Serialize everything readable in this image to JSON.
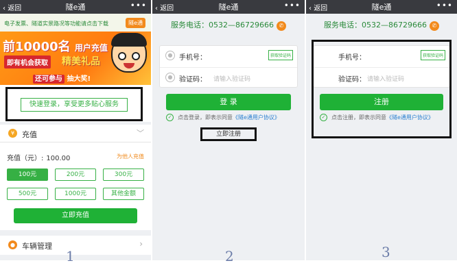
{
  "panel1": {
    "nav": {
      "back": "返回",
      "title": "隧e通",
      "more": "•••"
    },
    "notice": {
      "text": "电子发票、隧道实景路况等功能请点击下载",
      "button": "隧e通"
    },
    "banner": {
      "line1_big": "前10000名",
      "line1_small": "用户充值",
      "line2": "即有机会获取",
      "line3": "精美礼品",
      "line4_a": "还可参与",
      "line4_b": "抽大奖!"
    },
    "login_button": "快速登录，享受更多贴心服务",
    "recharge": {
      "title": "充值",
      "amount_label": "充值（元）:",
      "amount_value": "100.00",
      "for_others": "为他人充值",
      "options": [
        "100元",
        "200元",
        "300元",
        "500元",
        "1000元",
        "其他金额"
      ],
      "submit": "立即充值"
    },
    "vehicle": {
      "title": "车辆管理"
    },
    "number": "1"
  },
  "panel2": {
    "nav": {
      "back": "返回",
      "title": "隧e通",
      "more": "•••"
    },
    "service": "服务电话：0532—86729666",
    "phone_label": "手机号：",
    "get_code": "获取验证码",
    "code_label": "验证码：",
    "code_placeholder": "请输入验证码",
    "submit": "登 录",
    "agree": "点击登录，即表示同意",
    "agree_link": "《隧e通用户协议》",
    "register": "立即注册",
    "number": "2"
  },
  "panel3": {
    "nav": {
      "back": "返回",
      "title": "隧e通",
      "more": "•••"
    },
    "service": "服务电话：0532—86729666",
    "phone_label": "手机号：",
    "get_code": "获取验证码",
    "code_label": "验证码：",
    "code_placeholder": "请输入验证码",
    "submit": "注册",
    "agree": "点击注册，即表示同意",
    "agree_link": "《隧e通用户协议》",
    "number": "3"
  }
}
